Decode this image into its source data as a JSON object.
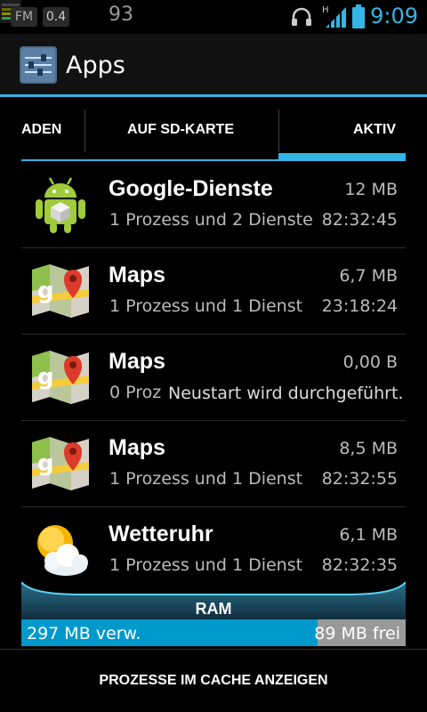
{
  "status_bar": {
    "fm_label": "FM",
    "load": "0.4",
    "number": "93",
    "time": "9:09",
    "icons": [
      "headphones-icon",
      "signal-h-icon",
      "battery-icon",
      "memory-meter-icon"
    ]
  },
  "action_bar": {
    "title": "Apps",
    "icon": "apps-settings-icon"
  },
  "tabs": [
    {
      "label": "ADEN"
    },
    {
      "label": "AUF SD-KARTE"
    },
    {
      "label": "AKTIV",
      "selected": true
    }
  ],
  "apps": [
    {
      "name": "Google-Dienste",
      "size": "12 MB",
      "desc": "1 Prozess und 2 Dienste",
      "time": "82:32:45",
      "icon": "android-icon"
    },
    {
      "name": "Maps",
      "size": "6,7 MB",
      "desc": "1 Prozess und 1 Dienst",
      "time": "23:18:24",
      "icon": "maps-icon"
    },
    {
      "name": "Maps",
      "size": "0,00 B",
      "desc": "0 Proz",
      "icon": "maps-icon"
    },
    {
      "name": "Maps",
      "size": "8,5 MB",
      "desc": "1 Prozess und 1 Dienst",
      "time": "82:32:55",
      "icon": "maps-icon"
    },
    {
      "name": "Wetteruhr",
      "size": "6,1 MB",
      "desc": "1 Prozess und 1 Dienst",
      "time": "82:32:35",
      "icon": "weather-icon"
    }
  ],
  "toast": "Neustart wird durchgeführt.",
  "ram": {
    "label": "RAM",
    "used_label": "297  MB verw.",
    "free_label": "89  MB frei",
    "used_fraction": 0.77
  },
  "bottom_button": "PROZESSE IM CACHE ANZEIGEN",
  "colors": {
    "accent": "#33b5e5",
    "ram_used": "#0099cc"
  }
}
